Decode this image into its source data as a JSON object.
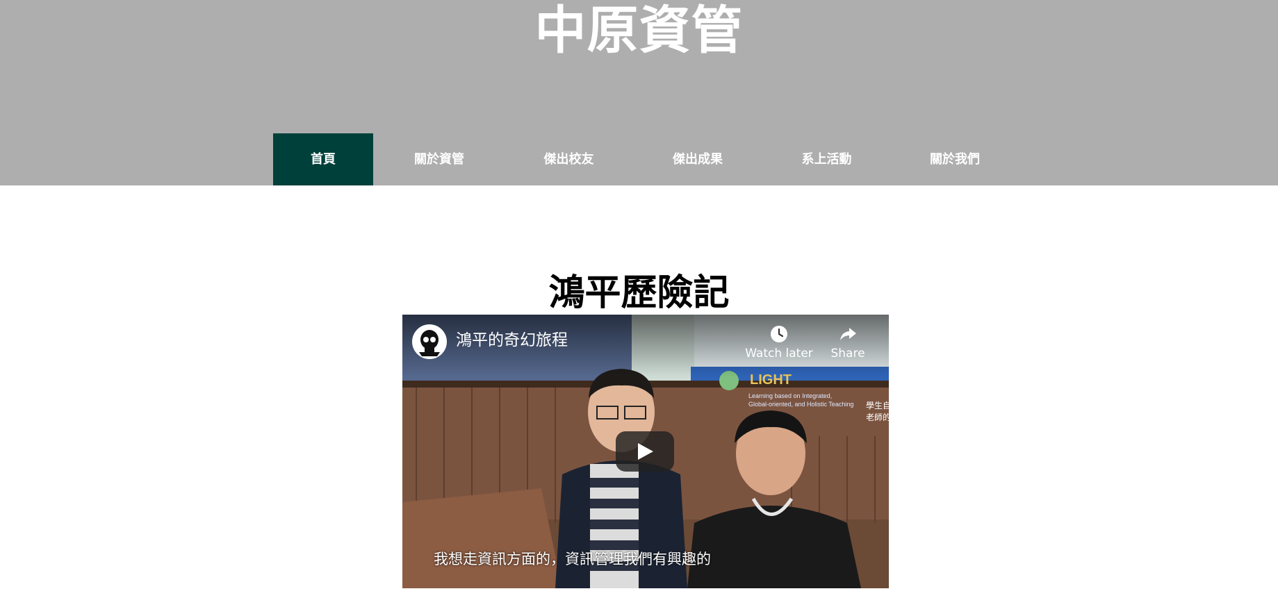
{
  "site": {
    "title": "中原資管"
  },
  "nav": {
    "items": [
      {
        "label": "首頁",
        "active": true
      },
      {
        "label": "關於資管",
        "active": false
      },
      {
        "label": "傑出校友",
        "active": false
      },
      {
        "label": "傑出成果",
        "active": false
      },
      {
        "label": "系上活動",
        "active": false
      },
      {
        "label": "關於我們",
        "active": false
      }
    ]
  },
  "main": {
    "title": "鴻平歷險記"
  },
  "video": {
    "channel_avatar_icon": "skull-avatar-icon",
    "title": "鴻平的奇幻旅程",
    "watch_later_label": "Watch later",
    "share_label": "Share",
    "play_icon": "play-icon",
    "caption": "我想走資訊方面的，資訊管理我們有興趣的",
    "poster_sign_text": "LIGHT",
    "poster_sign_line1": "Learning based on Integrated,",
    "poster_sign_line2": "Global-oriented, and Holistic Teaching",
    "poster_side_text1": "學生自",
    "poster_side_text2": "老師的"
  },
  "colors": {
    "header_bg": "#aeaeae",
    "nav_active_bg": "#00403b",
    "text_on_header": "#ffffff"
  }
}
